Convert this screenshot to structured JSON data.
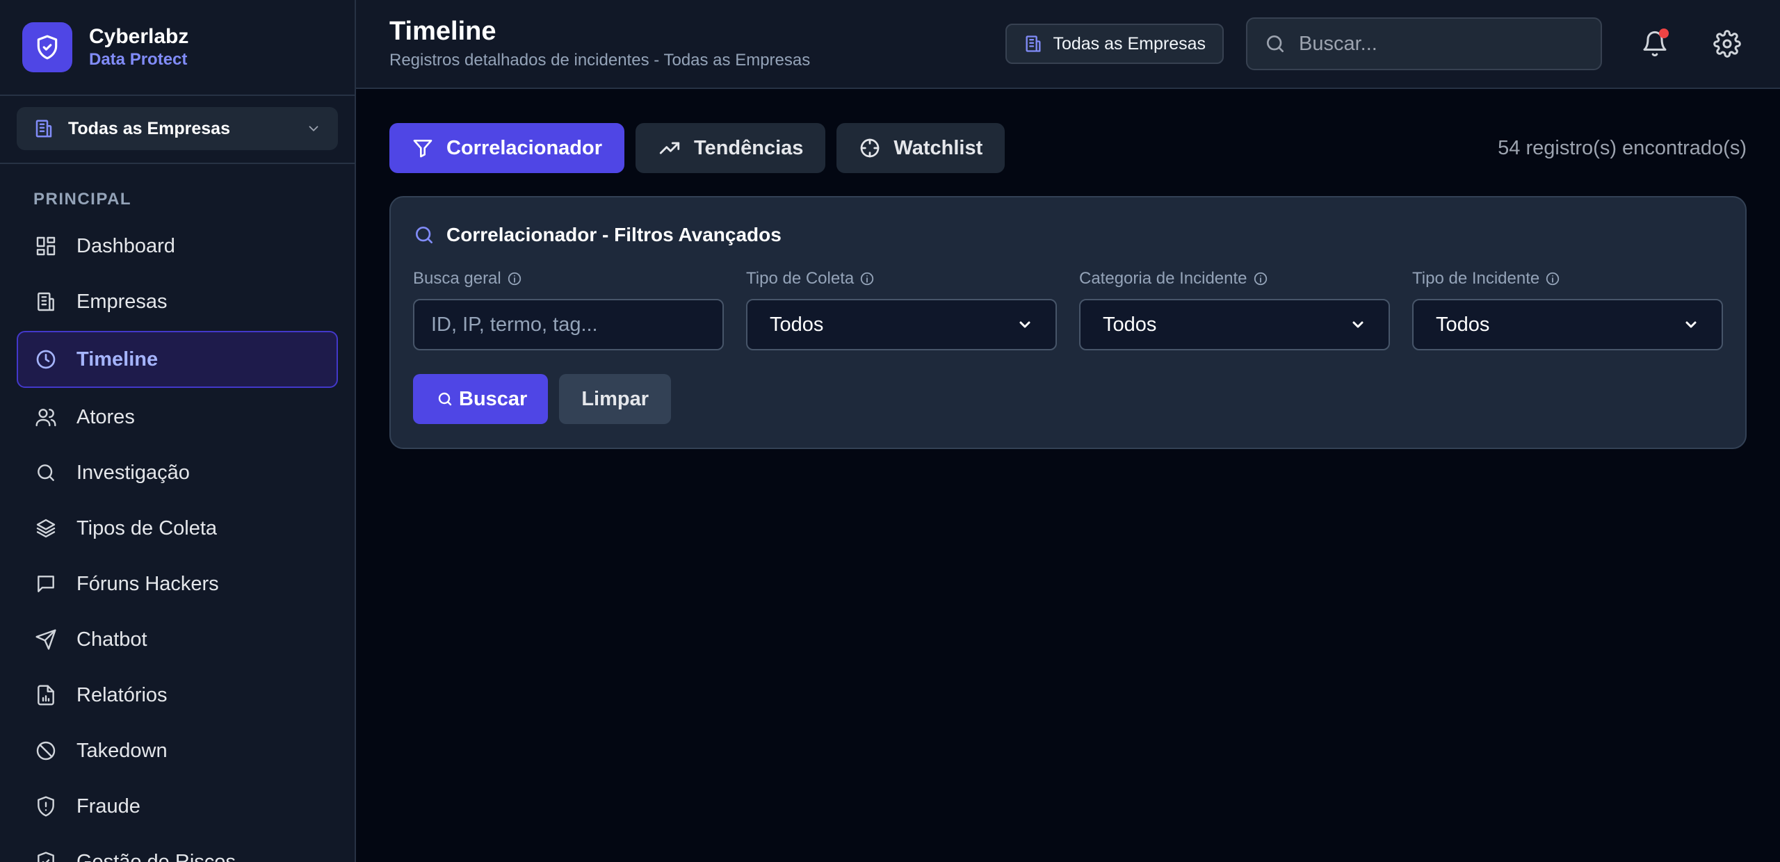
{
  "brand": {
    "name": "Cyberlabz",
    "subtitle": "Data Protect"
  },
  "company_selector": {
    "label": "Todas as Empresas"
  },
  "sidebar": {
    "section": "PRINCIPAL",
    "items": [
      {
        "label": "Dashboard",
        "icon": "dashboard-icon"
      },
      {
        "label": "Empresas",
        "icon": "building-icon"
      },
      {
        "label": "Timeline",
        "icon": "clock-icon",
        "active": true
      },
      {
        "label": "Atores",
        "icon": "users-icon"
      },
      {
        "label": "Investigação",
        "icon": "search-icon"
      },
      {
        "label": "Tipos de Coleta",
        "icon": "layers-icon"
      },
      {
        "label": "Fóruns Hackers",
        "icon": "message-icon"
      },
      {
        "label": "Chatbot",
        "icon": "send-icon"
      },
      {
        "label": "Relatórios",
        "icon": "report-icon"
      },
      {
        "label": "Takedown",
        "icon": "ban-icon"
      },
      {
        "label": "Fraude",
        "icon": "shield-alert-icon"
      },
      {
        "label": "Gestão de Riscos",
        "icon": "shield-check-icon"
      }
    ]
  },
  "header": {
    "title": "Timeline",
    "subtitle": "Registros detalhados de incidentes - Todas as Empresas",
    "company_badge": "Todas as Empresas",
    "search_placeholder": "Buscar..."
  },
  "tabs": [
    {
      "label": "Correlacionador",
      "icon": "filter-icon",
      "active": true
    },
    {
      "label": "Tendências",
      "icon": "trending-up-icon"
    },
    {
      "label": "Watchlist",
      "icon": "crosshair-icon"
    }
  ],
  "record_count": "54 registro(s) encontrado(s)",
  "panel": {
    "title": "Correlacionador - Filtros Avançados",
    "fields": {
      "busca_geral": {
        "label": "Busca geral",
        "placeholder": "ID, IP, termo, tag...",
        "value": ""
      },
      "tipo_coleta": {
        "label": "Tipo de Coleta",
        "value": "Todos"
      },
      "categoria": {
        "label": "Categoria de Incidente",
        "value": "Todos"
      },
      "tipo_incidente": {
        "label": "Tipo de Incidente",
        "value": "Todos"
      }
    },
    "search_button": "Buscar",
    "clear_button": "Limpar"
  },
  "colors": {
    "accent": "#4f46e5",
    "background": "#030712",
    "sidebar": "#111827",
    "panel": "#1e293b",
    "notification": "#ef4444"
  }
}
